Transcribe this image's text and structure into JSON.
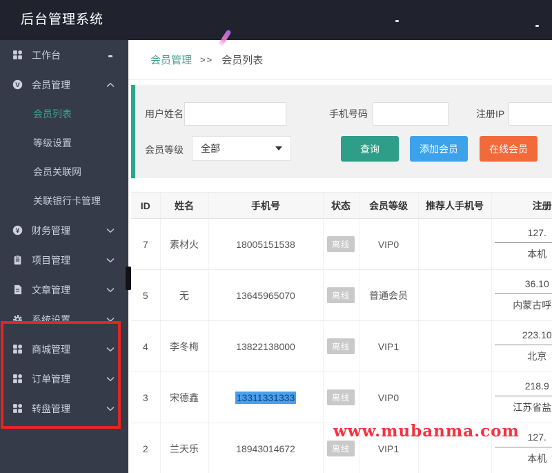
{
  "header": {
    "title": "后台管理系统"
  },
  "sidebar": {
    "items": [
      {
        "key": "workbench",
        "label": "工作台",
        "icon": "grid",
        "state": "dash",
        "children": []
      },
      {
        "key": "member-management",
        "label": "会员管理",
        "icon": "v-circle",
        "state": "expanded",
        "children": [
          {
            "key": "member-list",
            "label": "会员列表",
            "active": true
          },
          {
            "key": "level-settings",
            "label": "等级设置",
            "active": false
          },
          {
            "key": "member-network",
            "label": "会员关联网",
            "active": false
          },
          {
            "key": "bank-card-management",
            "label": "关联银行卡管理",
            "active": false
          }
        ]
      },
      {
        "key": "finance-management",
        "label": "财务管理",
        "icon": "yen-circle",
        "state": "collapsed",
        "children": []
      },
      {
        "key": "project-management",
        "label": "项目管理",
        "icon": "clipboard",
        "state": "collapsed",
        "children": []
      },
      {
        "key": "article-management",
        "label": "文章管理",
        "icon": "document",
        "state": "collapsed",
        "children": []
      },
      {
        "key": "system-settings",
        "label": "系统设置",
        "icon": "gear",
        "state": "collapsed",
        "children": []
      },
      {
        "key": "mall-management",
        "label": "商城管理",
        "icon": "grid",
        "state": "collapsed",
        "children": []
      },
      {
        "key": "order-management",
        "label": "订单管理",
        "icon": "grid",
        "state": "collapsed",
        "children": []
      },
      {
        "key": "wheel-management",
        "label": "转盘管理",
        "icon": "grid",
        "state": "collapsed",
        "children": []
      }
    ]
  },
  "breadcrumb": {
    "parent": "会员管理",
    "separator": ">>",
    "current": "会员列表"
  },
  "filters": {
    "username_label": "用户姓名",
    "phone_label": "手机号码",
    "ip_label": "注册IP",
    "level_label": "会员等级",
    "level_value": "全部",
    "username_value": "",
    "phone_value": "",
    "ip_value": "",
    "buttons": {
      "query": "查询",
      "add": "添加会员",
      "online": "在线会员"
    }
  },
  "table": {
    "columns": [
      "ID",
      "姓名",
      "手机号",
      "状态",
      "会员等级",
      "推荐人手机号",
      "注册IP"
    ],
    "rows": [
      {
        "id": "7",
        "name": "素材火",
        "phone": "18005151538",
        "status": "离线",
        "level": "VIP0",
        "referrer": "",
        "ip": "127.",
        "location": "本机",
        "phone_selected": false
      },
      {
        "id": "5",
        "name": "无",
        "phone": "13645965070",
        "status": "离线",
        "level": "普通会员",
        "referrer": "",
        "ip": "36.10",
        "location": "内蒙古呼和",
        "phone_selected": false
      },
      {
        "id": "4",
        "name": "李冬梅",
        "phone": "13822138000",
        "status": "离线",
        "level": "VIP1",
        "referrer": "",
        "ip": "223.10",
        "location": "北京",
        "phone_selected": false
      },
      {
        "id": "3",
        "name": "宋德鑫",
        "phone": "13311331333",
        "status": "离线",
        "level": "VIP0",
        "referrer": "",
        "ip": "218.9",
        "location": "江苏省盐城",
        "phone_selected": true
      },
      {
        "id": "2",
        "name": "兰天乐",
        "phone": "18943014672",
        "status": "离线",
        "level": "VIP1",
        "referrer": "",
        "ip": "127.",
        "location": "本机",
        "phone_selected": false
      }
    ]
  },
  "watermark": "www.mubanma.com",
  "colors": {
    "header_bg": "#20232e",
    "sidebar_bg": "#353b49",
    "accent_teal": "#2e9e88",
    "accent_blue": "#3da2ec",
    "accent_orange": "#f2693a",
    "active_menu_green": "#3fa390",
    "annotation_red": "#e02626",
    "selection_blue": "#4aa0ec",
    "watermark_red": "#f5323f",
    "offline_badge_gray": "#c9c9c9"
  }
}
